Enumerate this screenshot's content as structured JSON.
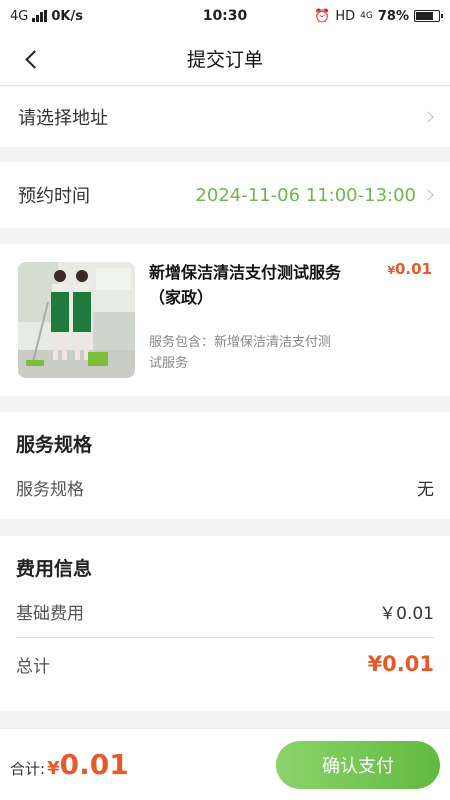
{
  "status_bar": {
    "network": "4G",
    "speed": "0K/s",
    "time": "10:30",
    "hd": "HD",
    "network2": "4G",
    "battery": "78%",
    "battery_level": 0.78
  },
  "nav": {
    "title": "提交订单"
  },
  "address": {
    "placeholder": "请选择地址"
  },
  "appointment": {
    "label": "预约时间",
    "value": "2024-11-06 11:00-13:00",
    "value_color": "#6cb94c"
  },
  "service_item": {
    "title": "新增保洁清洁支付测试服务（家政）",
    "currency": "¥",
    "price": "0.01",
    "description": "服务包含：新增保洁清洁支付测试服务"
  },
  "spec_section": {
    "title": "服务规格",
    "label": "服务规格",
    "value": "无"
  },
  "fee_section": {
    "title": "费用信息",
    "base_label": "基础费用",
    "base_value": "￥0.01",
    "total_label": "总计",
    "total_value": "¥0.01",
    "accent_color": "#e65a2a"
  },
  "footer": {
    "sum_label": "合计:",
    "currency": "¥",
    "amount": "0.01",
    "pay_label": "确认支付"
  }
}
